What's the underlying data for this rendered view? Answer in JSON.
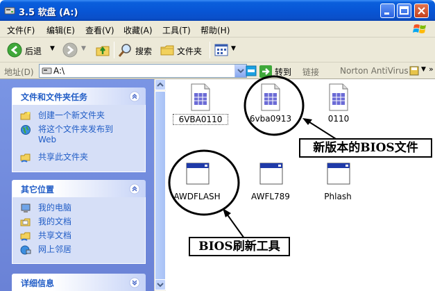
{
  "window": {
    "title": "3.5 软盘 (A:)",
    "icon": "floppy-drive-icon",
    "controls": [
      "minimize-icon",
      "maximize-icon",
      "close-icon"
    ]
  },
  "menu": {
    "items": [
      "文件(F)",
      "编辑(E)",
      "查看(V)",
      "收藏(A)",
      "工具(T)",
      "帮助(H)"
    ]
  },
  "toolbar": {
    "back_label": "后退",
    "search_label": "搜索",
    "folders_label": "文件夹"
  },
  "address": {
    "label": "地址(D)",
    "value": "A:\\",
    "go_label": "转到",
    "links_label": "链接",
    "norton_label": "Norton AntiVirus"
  },
  "left_pane": {
    "file_tasks": {
      "title": "文件和文件夹任务",
      "items": [
        {
          "label": "创建一个新文件夹",
          "icon": "new-folder-icon"
        },
        {
          "label": "将这个文件夹发布到",
          "label2": "Web",
          "icon": "publish-web-icon"
        },
        {
          "label": "共享此文件夹",
          "icon": "share-folder-icon"
        }
      ]
    },
    "other_places": {
      "title": "其它位置",
      "items": [
        {
          "label": "我的电脑",
          "icon": "my-computer-icon"
        },
        {
          "label": "我的文档",
          "icon": "my-documents-icon"
        },
        {
          "label": "共享文档",
          "icon": "shared-documents-icon"
        },
        {
          "label": "网上邻居",
          "icon": "network-places-icon"
        }
      ]
    },
    "details": {
      "title": "详细信息"
    }
  },
  "files": [
    {
      "name": "6VBA0110",
      "type": "binary-file-icon",
      "selected": true
    },
    {
      "name": "6vba0913",
      "type": "binary-file-icon",
      "selected": false
    },
    {
      "name": "0110",
      "type": "binary-file-icon",
      "selected": false
    },
    {
      "name": "AWDFLASH",
      "type": "application-icon",
      "selected": false
    },
    {
      "name": "AWFL789",
      "type": "application-icon",
      "selected": false
    },
    {
      "name": "Phlash",
      "type": "application-icon",
      "selected": false
    }
  ],
  "annotations": {
    "new_bios_label": "新版本的BIOS文件",
    "flash_tool_label": "BIOS刷新工具"
  }
}
